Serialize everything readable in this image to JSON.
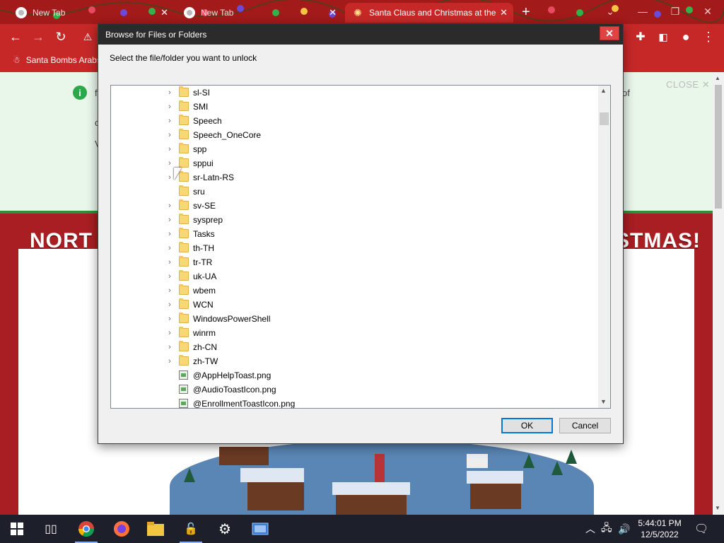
{
  "browser": {
    "tabs": [
      {
        "title": "New Tab"
      },
      {
        "title": "New Tab"
      },
      {
        "title": "Santa Claus and Christmas at the"
      }
    ],
    "bookmark": "Santa Bombs Arabs"
  },
  "page": {
    "notice_close": "CLOSE",
    "notice_fragments": [
      "of",
      "f",
      "c",
      "V"
    ],
    "banner_left": "NORT",
    "banner_right": "STMAS!"
  },
  "dialog": {
    "title": "Browse for Files or Folders",
    "prompt": "Select the file/folder you want to unlock",
    "items": [
      {
        "label": "sl-SI",
        "type": "folder",
        "expandable": true
      },
      {
        "label": "SMI",
        "type": "folder",
        "expandable": true
      },
      {
        "label": "Speech",
        "type": "folder",
        "expandable": true
      },
      {
        "label": "Speech_OneCore",
        "type": "folder",
        "expandable": true
      },
      {
        "label": "spp",
        "type": "folder",
        "expandable": true
      },
      {
        "label": "sppui",
        "type": "folder",
        "expandable": true
      },
      {
        "label": "sr-Latn-RS",
        "type": "folder",
        "expandable": true
      },
      {
        "label": "sru",
        "type": "folder",
        "expandable": false
      },
      {
        "label": "sv-SE",
        "type": "folder",
        "expandable": true
      },
      {
        "label": "sysprep",
        "type": "folder",
        "expandable": true
      },
      {
        "label": "Tasks",
        "type": "folder",
        "expandable": true
      },
      {
        "label": "th-TH",
        "type": "folder",
        "expandable": true
      },
      {
        "label": "tr-TR",
        "type": "folder",
        "expandable": true
      },
      {
        "label": "uk-UA",
        "type": "folder",
        "expandable": true
      },
      {
        "label": "wbem",
        "type": "folder",
        "expandable": true
      },
      {
        "label": "WCN",
        "type": "folder",
        "expandable": true
      },
      {
        "label": "WindowsPowerShell",
        "type": "folder",
        "expandable": true
      },
      {
        "label": "winrm",
        "type": "folder",
        "expandable": true
      },
      {
        "label": "zh-CN",
        "type": "folder",
        "expandable": true
      },
      {
        "label": "zh-TW",
        "type": "folder",
        "expandable": true
      },
      {
        "label": "@AppHelpToast.png",
        "type": "file",
        "expandable": false
      },
      {
        "label": "@AudioToastIcon.png",
        "type": "file",
        "expandable": false
      },
      {
        "label": "@EnrollmentToastIcon.png",
        "type": "file",
        "expandable": false
      }
    ],
    "ok_label": "OK",
    "cancel_label": "Cancel"
  },
  "taskbar": {
    "time": "5:44:01 PM",
    "date": "12/5/2022"
  },
  "colors": {
    "chrome_red": "#c62828",
    "dialog_title": "#2b2b2b",
    "ok_focus": "#0078d7",
    "notice_green": "#2aa84a"
  }
}
